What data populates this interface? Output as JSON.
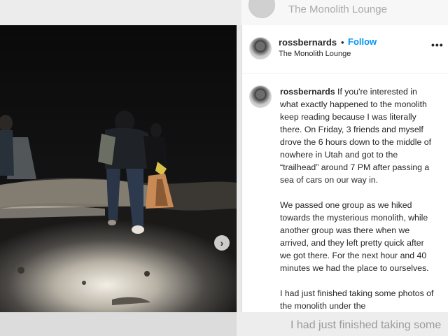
{
  "background": {
    "location_text": "The Monolith Lounge",
    "comment_preview": "I had just finished taking some"
  },
  "post": {
    "username": "rossbernards",
    "separator": "•",
    "follow_label": "Follow",
    "location": "The Monolith Lounge",
    "more_label": "•••",
    "next_arrow": "›",
    "caption": {
      "username": "rossbernards",
      "paragraphs": [
        "If you're interested in what exactly happened to the monolith keep reading because I was literally there. On Friday, 3 friends and myself drove the 6 hours down to the middle of nowhere in Utah and got to the “trailhead” around 7 PM after passing a sea of cars on our way in.",
        "We passed one group as we hiked towards the mysterious monolith, while another group was there when we arrived, and they left pretty quick after we got there. For the next hour and 40 minutes we had the place to ourselves.",
        "I had just finished taking some photos of the monolith under the"
      ]
    }
  },
  "colors": {
    "follow": "#0095f6",
    "text": "#262626",
    "muted": "#a9a9a9"
  }
}
